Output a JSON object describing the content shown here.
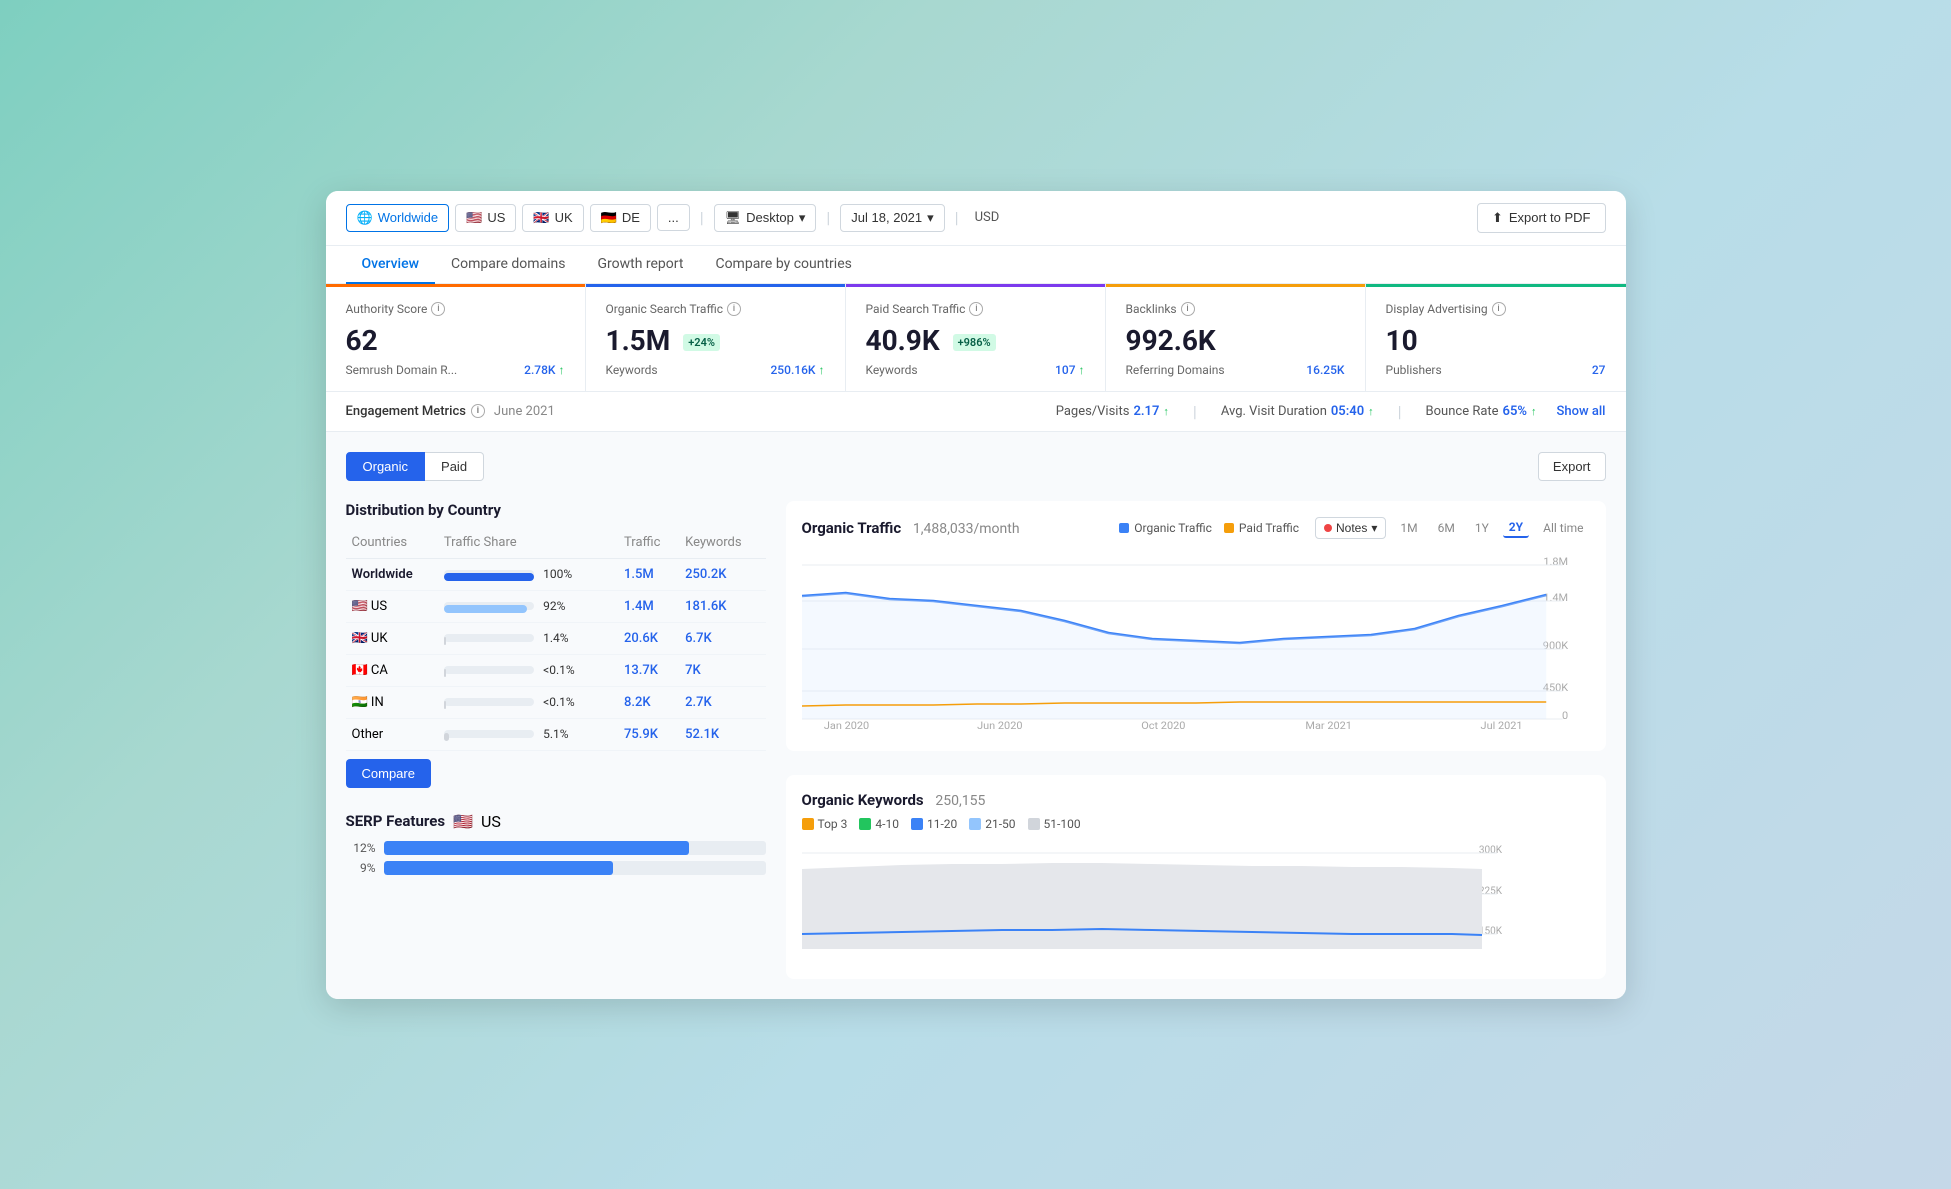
{
  "topbar": {
    "filters": [
      {
        "id": "worldwide",
        "label": "Worldwide",
        "flag": "🌐",
        "active": true
      },
      {
        "id": "us",
        "label": "US",
        "flag": "🇺🇸",
        "active": false
      },
      {
        "id": "uk",
        "label": "UK",
        "flag": "🇬🇧",
        "active": false
      },
      {
        "id": "de",
        "label": "DE",
        "flag": "🇩🇪",
        "active": false
      },
      {
        "id": "more",
        "label": "...",
        "flag": "",
        "active": false
      }
    ],
    "device": "Desktop",
    "date": "Jul 18, 2021",
    "currency": "USD",
    "export_label": "Export to PDF"
  },
  "nav": {
    "tabs": [
      {
        "id": "overview",
        "label": "Overview",
        "active": true
      },
      {
        "id": "compare-domains",
        "label": "Compare domains",
        "active": false
      },
      {
        "id": "growth-report",
        "label": "Growth report",
        "active": false
      },
      {
        "id": "compare-countries",
        "label": "Compare by countries",
        "active": false
      }
    ]
  },
  "metrics": [
    {
      "id": "authority",
      "title": "Authority Score",
      "value": "62",
      "badge": null,
      "sub_label": "Semrush Domain R...",
      "sub_value": "2.78K",
      "sub_arrow": "↑",
      "color_class": "authority"
    },
    {
      "id": "organic",
      "title": "Organic Search Traffic",
      "value": "1.5M",
      "badge": "+24%",
      "badge_type": "green",
      "sub_label": "Keywords",
      "sub_value": "250.16K",
      "sub_arrow": "↑",
      "color_class": "organic"
    },
    {
      "id": "paid",
      "title": "Paid Search Traffic",
      "value": "40.9K",
      "badge": "+986%",
      "badge_type": "green",
      "sub_label": "Keywords",
      "sub_value": "107",
      "sub_arrow": "↑",
      "color_class": "paid"
    },
    {
      "id": "backlinks",
      "title": "Backlinks",
      "value": "992.6K",
      "badge": null,
      "sub_label": "Referring Domains",
      "sub_value": "16.25K",
      "sub_arrow": "",
      "color_class": "backlinks"
    },
    {
      "id": "display",
      "title": "Display Advertising",
      "value": "10",
      "badge": null,
      "sub_label": "Publishers",
      "sub_value": "27",
      "sub_arrow": "",
      "color_class": "display"
    }
  ],
  "engagement": {
    "label": "Engagement Metrics",
    "date": "June 2021",
    "pages_visits_label": "Pages/Visits",
    "pages_visits_value": "2.17",
    "pages_visits_arrow": "↑",
    "avg_visit_label": "Avg. Visit Duration",
    "avg_visit_value": "05:40",
    "avg_visit_arrow": "↑",
    "bounce_rate_label": "Bounce Rate",
    "bounce_rate_value": "65%",
    "bounce_rate_arrow": "↑",
    "show_all": "Show all"
  },
  "content": {
    "toggle": {
      "organic_label": "Organic",
      "paid_label": "Paid",
      "active": "organic"
    },
    "export_label": "Export"
  },
  "distribution": {
    "title": "Distribution by Country",
    "columns": [
      "Countries",
      "Traffic Share",
      "Traffic",
      "Keywords"
    ],
    "rows": [
      {
        "country": "Worldwide",
        "flag": "",
        "bold": true,
        "bar_pct": 100,
        "pct_label": "100%",
        "traffic": "1.5M",
        "keywords": "250.2K"
      },
      {
        "country": "US",
        "flag": "🇺🇸",
        "bold": false,
        "bar_pct": 92,
        "pct_label": "92%",
        "traffic": "1.4M",
        "keywords": "181.6K"
      },
      {
        "country": "UK",
        "flag": "🇬🇧",
        "bold": false,
        "bar_pct": 1,
        "pct_label": "1.4%",
        "traffic": "20.6K",
        "keywords": "6.7K"
      },
      {
        "country": "CA",
        "flag": "🇨🇦",
        "bold": false,
        "bar_pct": 0.5,
        "pct_label": "<0.1%",
        "traffic": "13.7K",
        "keywords": "7K"
      },
      {
        "country": "IN",
        "flag": "🇮🇳",
        "bold": false,
        "bar_pct": 0.5,
        "pct_label": "<0.1%",
        "traffic": "8.2K",
        "keywords": "2.7K"
      },
      {
        "country": "Other",
        "flag": "",
        "bold": false,
        "bar_pct": 5,
        "pct_label": "5.1%",
        "traffic": "75.9K",
        "keywords": "52.1K"
      }
    ],
    "compare_label": "Compare"
  },
  "serp": {
    "title": "SERP Features",
    "flag": "🇺🇸",
    "country": "US",
    "bars": [
      {
        "pct": "12%",
        "width": 80
      },
      {
        "pct": "9%",
        "width": 60,
        "highlight": true
      }
    ]
  },
  "organic_traffic_chart": {
    "title": "Organic Traffic",
    "value": "1,488,033/month",
    "legend": [
      {
        "label": "Organic Traffic",
        "color": "blue"
      },
      {
        "label": "Paid Traffic",
        "color": "orange"
      }
    ],
    "notes_label": "Notes",
    "time_periods": [
      "1M",
      "6M",
      "1Y",
      "2Y",
      "All time"
    ],
    "active_period": "2Y",
    "x_labels": [
      "Jan 2020",
      "Jun 2020",
      "Oct 2020",
      "Mar 2021",
      "Jul 2021"
    ],
    "y_labels": [
      "1.8M",
      "1.4M",
      "900K",
      "450K",
      "0"
    ]
  },
  "keywords_chart": {
    "title": "Organic Keywords",
    "value": "250,155",
    "legend": [
      {
        "label": "Top 3",
        "color": "yellow"
      },
      {
        "label": "4-10",
        "color": "green"
      },
      {
        "label": "11-20",
        "color": "blue"
      },
      {
        "label": "21-50",
        "color": "lightblue"
      },
      {
        "label": "51-100",
        "color": "gray"
      }
    ],
    "y_labels": [
      "300K",
      "225K",
      "150K"
    ]
  }
}
